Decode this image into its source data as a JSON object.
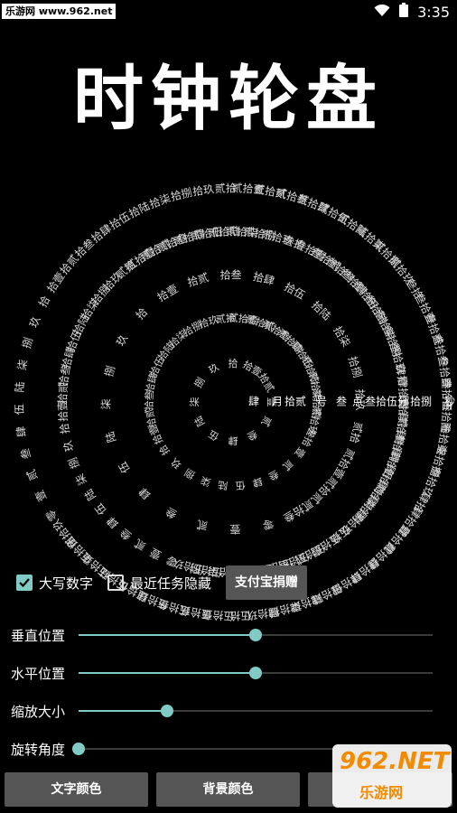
{
  "status_bar": {
    "site": "乐游网 www.962.net",
    "time": "3:35",
    "wifi_icon": "wifi-icon",
    "battery_icon": "battery-icon"
  },
  "app_title": "时钟轮盘",
  "clock": {
    "now_row": [
      "肆",
      "月",
      "拾贰",
      "号",
      "叁",
      "点",
      "叁拾伍分",
      "拾捌",
      "秒"
    ],
    "rings": [
      {
        "name": "months",
        "labels": [
          "壹",
          "贰",
          "叁",
          "肆",
          "伍",
          "陆",
          "柒",
          "捌",
          "玖",
          "拾",
          "拾壹",
          "拾贰"
        ]
      },
      {
        "name": "days",
        "labels": [
          "壹",
          "贰",
          "叁",
          "肆",
          "伍",
          "陆",
          "柒",
          "捌",
          "玖",
          "拾",
          "拾壹",
          "拾贰",
          "拾叁",
          "拾肆",
          "拾伍",
          "拾陆",
          "拾柒",
          "拾捌",
          "拾玖",
          "贰拾",
          "贰拾壹",
          "贰拾贰",
          "贰拾叁",
          "贰拾肆",
          "贰拾伍",
          "贰拾陆",
          "贰拾柒",
          "贰拾捌",
          "贰拾玖",
          "叁拾"
        ]
      },
      {
        "name": "hours",
        "labels": [
          "零",
          "壹",
          "贰",
          "叁",
          "肆",
          "伍",
          "陆",
          "柒",
          "捌",
          "玖",
          "拾",
          "拾壹",
          "拾贰",
          "拾叁",
          "拾肆",
          "拾伍",
          "拾陆",
          "拾柒",
          "拾捌",
          "拾玖",
          "贰拾",
          "贰拾壹",
          "贰拾贰",
          "贰拾叁"
        ]
      },
      {
        "name": "minutes",
        "labels": [
          "零",
          "壹",
          "贰",
          "叁",
          "肆",
          "伍",
          "陆",
          "柒",
          "捌",
          "玖",
          "拾",
          "拾壹",
          "拾贰",
          "拾叁",
          "拾肆",
          "拾伍",
          "拾陆",
          "拾柒",
          "拾捌",
          "拾玖",
          "贰拾",
          "贰拾壹",
          "贰拾贰",
          "贰拾叁",
          "贰拾肆",
          "贰拾伍",
          "贰拾陆",
          "贰拾柒",
          "贰拾捌",
          "贰拾玖",
          "叁拾",
          "叁拾壹",
          "叁拾贰",
          "叁拾叁",
          "叁拾肆",
          "叁拾伍",
          "叁拾陆",
          "叁拾柒",
          "叁拾捌",
          "叁拾玖",
          "肆拾",
          "肆拾壹",
          "肆拾贰",
          "肆拾叁",
          "肆拾肆",
          "肆拾伍",
          "肆拾陆",
          "肆拾柒",
          "肆拾捌",
          "肆拾玖",
          "伍拾",
          "伍拾壹",
          "伍拾贰",
          "伍拾叁",
          "伍拾肆",
          "伍拾伍",
          "伍拾陆",
          "伍拾柒",
          "伍拾捌",
          "伍拾玖"
        ]
      },
      {
        "name": "seconds",
        "labels": [
          "零",
          "壹",
          "贰",
          "叁",
          "肆",
          "伍",
          "陆",
          "柒",
          "捌",
          "玖",
          "拾",
          "拾壹",
          "拾贰",
          "拾叁",
          "拾肆",
          "拾伍",
          "拾陆",
          "拾柒",
          "拾捌",
          "拾玖",
          "贰拾",
          "贰拾壹",
          "贰拾贰",
          "贰拾叁",
          "贰拾肆",
          "贰拾伍",
          "贰拾陆",
          "贰拾柒",
          "贰拾捌",
          "贰拾玖",
          "叁拾",
          "叁拾壹",
          "叁拾贰",
          "叁拾叁",
          "叁拾肆",
          "叁拾伍",
          "叁拾陆",
          "叁拾柒",
          "叁拾捌",
          "叁拾玖",
          "肆拾",
          "肆拾壹",
          "肆拾贰",
          "肆拾叁",
          "肆拾肆",
          "肆拾伍",
          "肆拾陆",
          "肆拾柒",
          "肆拾捌",
          "肆拾玖",
          "伍拾",
          "伍拾壹",
          "伍拾贰",
          "伍拾叁",
          "伍拾肆",
          "伍拾伍",
          "伍拾陆",
          "伍拾柒",
          "伍拾捌",
          "伍拾玖"
        ]
      }
    ]
  },
  "options": {
    "uppercase": {
      "label": "大写数字",
      "checked": true
    },
    "hide_recents": {
      "label": "最近任务隐藏",
      "checked": false
    },
    "donate_label": "支付宝捐赠"
  },
  "sliders": [
    {
      "label": "垂直位置",
      "value": 0.5
    },
    {
      "label": "水平位置",
      "value": 0.5
    },
    {
      "label": "缩放大小",
      "value": 0.25
    },
    {
      "label": "旋转角度",
      "value": 0.0
    }
  ],
  "buttons": {
    "text_color": "文字颜色",
    "bg_color": "背景颜色"
  },
  "watermark": {
    "top": "962.NET",
    "bottom": "乐游网"
  },
  "colors": {
    "accent": "#80cbc4",
    "button_bg": "#555555",
    "background": "#000000",
    "text": "#ffffff"
  }
}
